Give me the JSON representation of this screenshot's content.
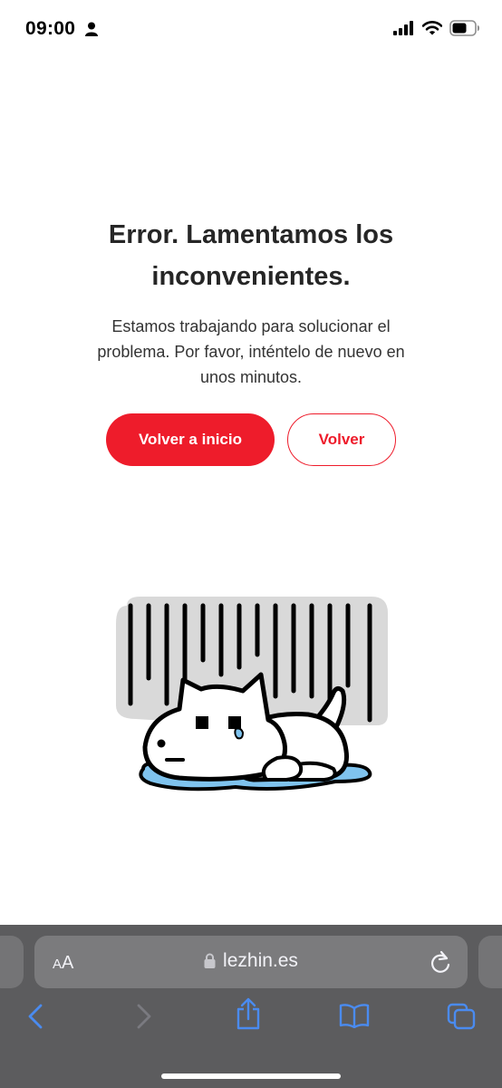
{
  "status_bar": {
    "time": "09:00",
    "icons": [
      "person-icon",
      "signal-icon",
      "wifi-icon",
      "battery-icon"
    ]
  },
  "error": {
    "title": "Error. Lamentamos los inconvenientes.",
    "message": "Estamos trabajando para solucionar el problema. Por favor, inténtelo de nuevo en unos minutos.",
    "primary_button": "Volver a inicio",
    "secondary_button": "Volver"
  },
  "browser": {
    "text_size_label_small": "A",
    "text_size_label_large": "A",
    "url": "lezhin.es",
    "toolbar_icons": [
      "back-icon",
      "forward-icon",
      "share-icon",
      "bookmarks-icon",
      "tabs-icon"
    ]
  },
  "colors": {
    "accent": "#ee1c2b",
    "toolbar_bg": "#5c5c5e",
    "toolbar_icon": "#4a8bf0"
  }
}
